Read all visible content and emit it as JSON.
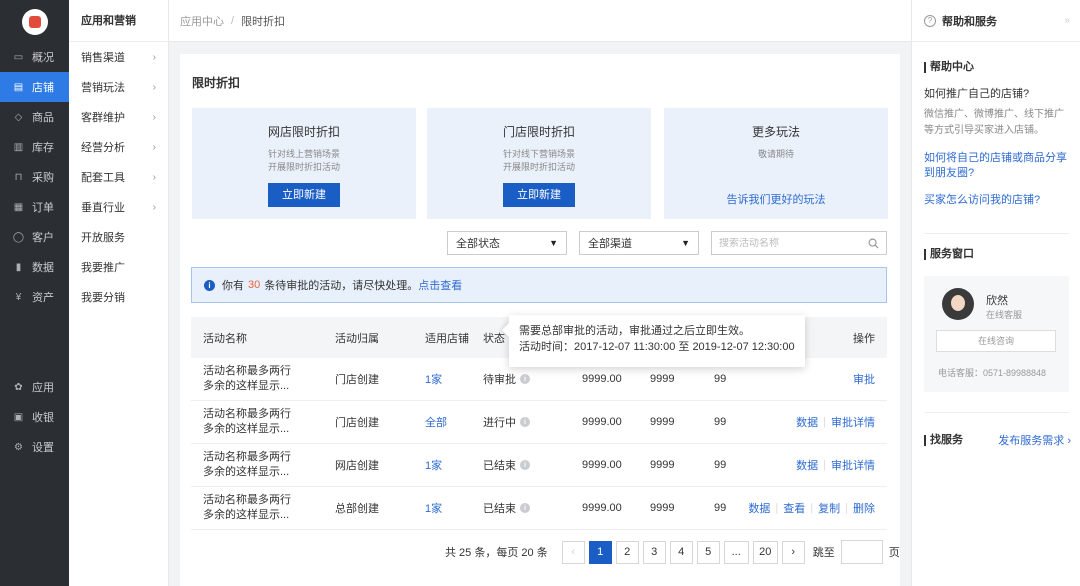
{
  "colors": {
    "primary": "#1a5dc4",
    "link": "#2e6bd1",
    "sidebar_bg": "#2b2e33",
    "active_nav": "#2e7be6",
    "notice_count": "#e8623b"
  },
  "nav": {
    "items": [
      {
        "label": "概况",
        "icon": "monitor-icon",
        "glyph": "▭"
      },
      {
        "label": "店铺",
        "icon": "store-icon",
        "glyph": "▤",
        "active": true
      },
      {
        "label": "商品",
        "icon": "tag-icon",
        "glyph": "◇"
      },
      {
        "label": "库存",
        "icon": "warehouse-icon",
        "glyph": "▥"
      },
      {
        "label": "采购",
        "icon": "cart-icon",
        "glyph": "⊓"
      },
      {
        "label": "订单",
        "icon": "order-icon",
        "glyph": "▦"
      },
      {
        "label": "客户",
        "icon": "user-icon",
        "glyph": "◯"
      },
      {
        "label": "数据",
        "icon": "chart-icon",
        "glyph": "▮"
      },
      {
        "label": "资产",
        "icon": "yen-icon",
        "glyph": "¥"
      }
    ],
    "bottom": [
      {
        "label": "应用",
        "icon": "apps-icon",
        "glyph": "✿"
      },
      {
        "label": "收银",
        "icon": "cashier-icon",
        "glyph": "▣"
      },
      {
        "label": "设置",
        "icon": "gear-icon",
        "glyph": "⚙"
      }
    ]
  },
  "subnav": {
    "title": "应用和营销",
    "items": [
      {
        "label": "销售渠道",
        "arrow": true
      },
      {
        "label": "营销玩法",
        "arrow": true
      },
      {
        "label": "客群维护",
        "arrow": true
      },
      {
        "label": "经营分析",
        "arrow": true
      },
      {
        "label": "配套工具",
        "arrow": true
      },
      {
        "label": "垂直行业",
        "arrow": true
      },
      {
        "label": "开放服务",
        "arrow": false
      },
      {
        "label": "我要推广",
        "arrow": false
      },
      {
        "label": "我要分销",
        "arrow": false
      }
    ]
  },
  "breadcrumb": {
    "parent": "应用中心",
    "separator": "/",
    "current": "限时折扣"
  },
  "page": {
    "title": "限时折扣"
  },
  "cards": [
    {
      "title": "网店限时折扣",
      "desc": "针对线上营销场景\n开展限时折扣活动",
      "button": "立即新建"
    },
    {
      "title": "门店限时折扣",
      "desc": "针对线下营销场景\n开展限时折扣活动",
      "button": "立即新建"
    },
    {
      "title": "更多玩法",
      "desc": "敬请期待",
      "link": "告诉我们更好的玩法"
    }
  ],
  "filters": {
    "status": "全部状态",
    "channel": "全部渠道",
    "search_placeholder": "搜索活动名称"
  },
  "notice": {
    "prefix": "你有",
    "count": "30",
    "suffix": "条待审批的活动，请尽快处理。",
    "link": "点击查看"
  },
  "table": {
    "headers": {
      "name": "活动名称",
      "owner": "活动归属",
      "store": "适用店铺",
      "status": "状态",
      "ops": "操作"
    },
    "rows": [
      {
        "name1": "活动名称最多两行",
        "name2": "多余的这样显示...",
        "owner": "门店创建",
        "store": "1家",
        "status": "待审批",
        "v1": "9999.00",
        "v2": "9999",
        "v3": "99",
        "ops": [
          "审批"
        ]
      },
      {
        "name1": "活动名称最多两行",
        "name2": "多余的这样显示...",
        "owner": "门店创建",
        "store": "全部",
        "status": "进行中",
        "v1": "9999.00",
        "v2": "9999",
        "v3": "99",
        "ops": [
          "数据",
          "审批详情"
        ]
      },
      {
        "name1": "活动名称最多两行",
        "name2": "多余的这样显示...",
        "owner": "网店创建",
        "store": "1家",
        "status": "已结束",
        "v1": "9999.00",
        "v2": "9999",
        "v3": "99",
        "ops": [
          "数据",
          "审批详情"
        ]
      },
      {
        "name1": "活动名称最多两行",
        "name2": "多余的这样显示...",
        "owner": "总部创建",
        "store": "1家",
        "status": "已结束",
        "v1": "9999.00",
        "v2": "9999",
        "v3": "99",
        "ops": [
          "数据",
          "查看",
          "复制",
          "删除"
        ]
      }
    ]
  },
  "tooltip": {
    "line1": "需要总部审批的活动，审批通过之后立即生效。",
    "line2": "活动时间：2017-12-07 11:30:00 至 2019-12-07 12:30:00"
  },
  "pagination": {
    "total": "共 25 条，每页 20 条",
    "prev": "‹",
    "pages": [
      "1",
      "2",
      "3",
      "4",
      "5",
      "...",
      "20"
    ],
    "current": "1",
    "next": "›",
    "jump_label": "跳至",
    "page_unit": "页"
  },
  "help": {
    "header": "帮助和服务",
    "collapse": "»",
    "center_title": "帮助中心",
    "q1": "如何推广自己的店铺?",
    "a1": "微信推广、微博推广、线下推广等方式引导买家进入店铺。",
    "link1": "如何将自己的店铺或商品分享到朋友圈?",
    "link2": "买家怎么访问我的店铺?"
  },
  "service": {
    "title": "服务窗口",
    "name": "欣然",
    "role": "在线客服",
    "consult": "在线咨询",
    "phone": "电话客服：0571-89988848"
  },
  "find": {
    "title": "找服务",
    "link": "发布服务需求 ›"
  }
}
